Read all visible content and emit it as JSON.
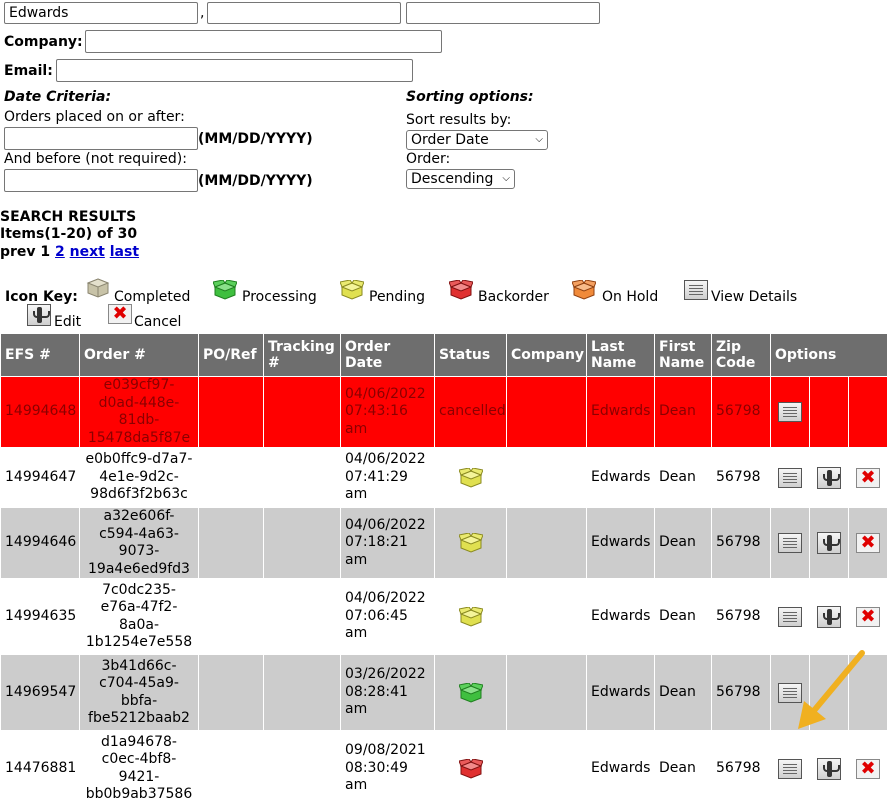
{
  "name_fields": {
    "last": "Edwards",
    "first": "",
    "middle": "",
    "separator": ","
  },
  "company": {
    "label": "Company:",
    "value": ""
  },
  "email": {
    "label": "Email:",
    "value": ""
  },
  "date_criteria": {
    "heading": "Date Criteria:",
    "after_label": "Orders placed on or after:",
    "after_value": "",
    "before_label": "And before (not required):",
    "before_value": "",
    "format_hint": "(MM/DD/YYYY)"
  },
  "sorting": {
    "heading": "Sorting options:",
    "sort_label": "Sort results by:",
    "sort_value": "Order Date",
    "order_label": "Order:",
    "order_value": "Descending"
  },
  "results": {
    "title": "SEARCH RESULTS",
    "count": "Items(1-20) of 30",
    "pager": {
      "prev": "prev",
      "current": "1",
      "page2": "2",
      "next": "next",
      "last": "last"
    }
  },
  "icon_key": {
    "label": "Icon Key:",
    "completed": "Completed",
    "processing": "Processing",
    "pending": "Pending",
    "backorder": "Backorder",
    "on_hold": "On Hold",
    "view_details": "View Details",
    "edit": "Edit",
    "cancel": "Cancel"
  },
  "colors": {
    "completed": "#c8c3a8",
    "processing": "#3fbf3f",
    "pending": "#e0e050",
    "backorder": "#e03030",
    "on_hold": "#f08a3a",
    "cancel_row": "#ff0000",
    "arrow": "#f0b020"
  },
  "table": {
    "headers": {
      "efs": "EFS #",
      "order": "Order #",
      "po": "PO/Ref",
      "tracking": "Tracking #",
      "date": "Order Date",
      "status": "Status",
      "company": "Company",
      "last": "Last Name",
      "first": "First Name",
      "zip": "Zip Code",
      "options": "Options"
    },
    "rows": [
      {
        "efs": "14994648",
        "order": "e039cf97-d0ad-448e-81db-15478da5f87e",
        "date": "04/06/2022 07:43:16 am",
        "status": "cancelled",
        "last": "Edwards",
        "first": "Dean",
        "zip": "56798"
      },
      {
        "efs": "14994647",
        "order": "e0b0ffc9-d7a7-4e1e-9d2c-98d6f3f2b63c",
        "date": "04/06/2022 07:41:29 am",
        "status": "pending-icon",
        "last": "Edwards",
        "first": "Dean",
        "zip": "56798"
      },
      {
        "efs": "14994646",
        "order": "a32e606f-c594-4a63-9073-19a4e6ed9fd3",
        "date": "04/06/2022 07:18:21 am",
        "status": "pending-icon",
        "last": "Edwards",
        "first": "Dean",
        "zip": "56798"
      },
      {
        "efs": "14994635",
        "order": "7c0dc235-e76a-47f2-8a0a-1b1254e7e558",
        "date": "04/06/2022 07:06:45 am",
        "status": "pending-icon",
        "last": "Edwards",
        "first": "Dean",
        "zip": "56798"
      },
      {
        "efs": "14969547",
        "order": "3b41d66c-c704-45a9-bbfa-fbe5212baab2",
        "date": "03/26/2022 08:28:41 am",
        "status": "processing-icon",
        "last": "Edwards",
        "first": "Dean",
        "zip": "56798"
      },
      {
        "efs": "14476881",
        "order": "d1a94678-c0ec-4bf8-9421-bb0b9ab37586",
        "date": "09/08/2021 08:30:49 am",
        "status": "backorder-icon",
        "last": "Edwards",
        "first": "Dean",
        "zip": "56798"
      }
    ]
  }
}
